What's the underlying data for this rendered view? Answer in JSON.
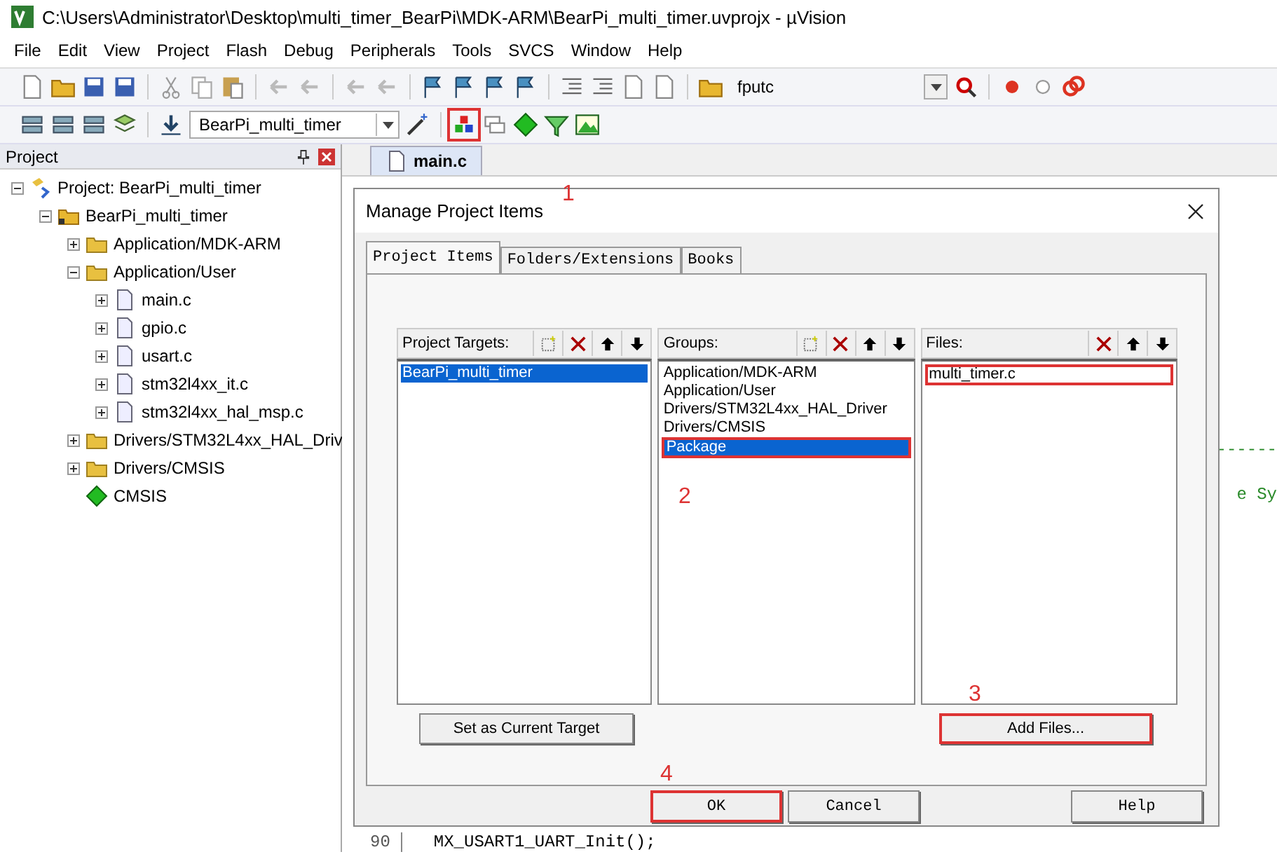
{
  "window": {
    "title": "C:\\Users\\Administrator\\Desktop\\multi_timer_BearPi\\MDK-ARM\\BearPi_multi_timer.uvprojx - µVision"
  },
  "menu": [
    "File",
    "Edit",
    "View",
    "Project",
    "Flash",
    "Debug",
    "Peripherals",
    "Tools",
    "SVCS",
    "Window",
    "Help"
  ],
  "toolbar": {
    "find_combo": "fputc",
    "target_combo": "BearPi_multi_timer",
    "manage_button_annotated": true
  },
  "project_panel": {
    "title": "Project",
    "tree": [
      {
        "label": "Project: BearPi_multi_timer",
        "kind": "project",
        "expanded": true,
        "children": [
          {
            "label": "BearPi_multi_timer",
            "kind": "target",
            "expanded": true,
            "children": [
              {
                "label": "Application/MDK-ARM",
                "kind": "folder",
                "expanded": false
              },
              {
                "label": "Application/User",
                "kind": "folder",
                "expanded": true,
                "children": [
                  {
                    "label": "main.c",
                    "kind": "file",
                    "expanded": false
                  },
                  {
                    "label": "gpio.c",
                    "kind": "file",
                    "expanded": false
                  },
                  {
                    "label": "usart.c",
                    "kind": "file",
                    "expanded": false
                  },
                  {
                    "label": "stm32l4xx_it.c",
                    "kind": "file",
                    "expanded": false
                  },
                  {
                    "label": "stm32l4xx_hal_msp.c",
                    "kind": "file",
                    "expanded": false
                  }
                ]
              },
              {
                "label": "Drivers/STM32L4xx_HAL_Driv",
                "kind": "folder",
                "expanded": false
              },
              {
                "label": "Drivers/CMSIS",
                "kind": "folder",
                "expanded": false
              },
              {
                "label": "CMSIS",
                "kind": "component"
              }
            ]
          }
        ]
      }
    ]
  },
  "editor": {
    "tab": "main.c",
    "code_fragment_1": "------",
    "code_fragment_2": "e Sy",
    "line_number": "90",
    "code_line": "MX_USART1_UART_Init();"
  },
  "dialog": {
    "title": "Manage Project Items",
    "tabs": [
      {
        "label": "Project Items",
        "selected": true
      },
      {
        "label": "Folders/Extensions",
        "selected": false
      },
      {
        "label": "Books",
        "selected": false
      }
    ],
    "targets": {
      "label": "Project Targets:",
      "items": [
        {
          "label": "BearPi_multi_timer",
          "selected": true,
          "annotated": false
        }
      ]
    },
    "groups": {
      "label": "Groups:",
      "items": [
        {
          "label": "Application/MDK-ARM",
          "selected": false,
          "annotated": false
        },
        {
          "label": "Application/User",
          "selected": false,
          "annotated": false
        },
        {
          "label": "Drivers/STM32L4xx_HAL_Driver",
          "selected": false,
          "annotated": false
        },
        {
          "label": "Drivers/CMSIS",
          "selected": false,
          "annotated": false
        },
        {
          "label": "Package",
          "selected": true,
          "annotated": true
        }
      ]
    },
    "files": {
      "label": "Files:",
      "items": [
        {
          "label": "multi_timer.c",
          "selected": false,
          "annotated": true
        }
      ]
    },
    "set_target_button": "Set as Current Target",
    "add_files_button": {
      "label": "Add Files...",
      "annotated": true
    },
    "buttons": [
      {
        "label": "OK",
        "annotated": true
      },
      {
        "label": "Cancel",
        "annotated": false
      },
      {
        "label": "Help",
        "annotated": false
      }
    ],
    "callouts": [
      "1",
      "2",
      "3",
      "4"
    ]
  }
}
